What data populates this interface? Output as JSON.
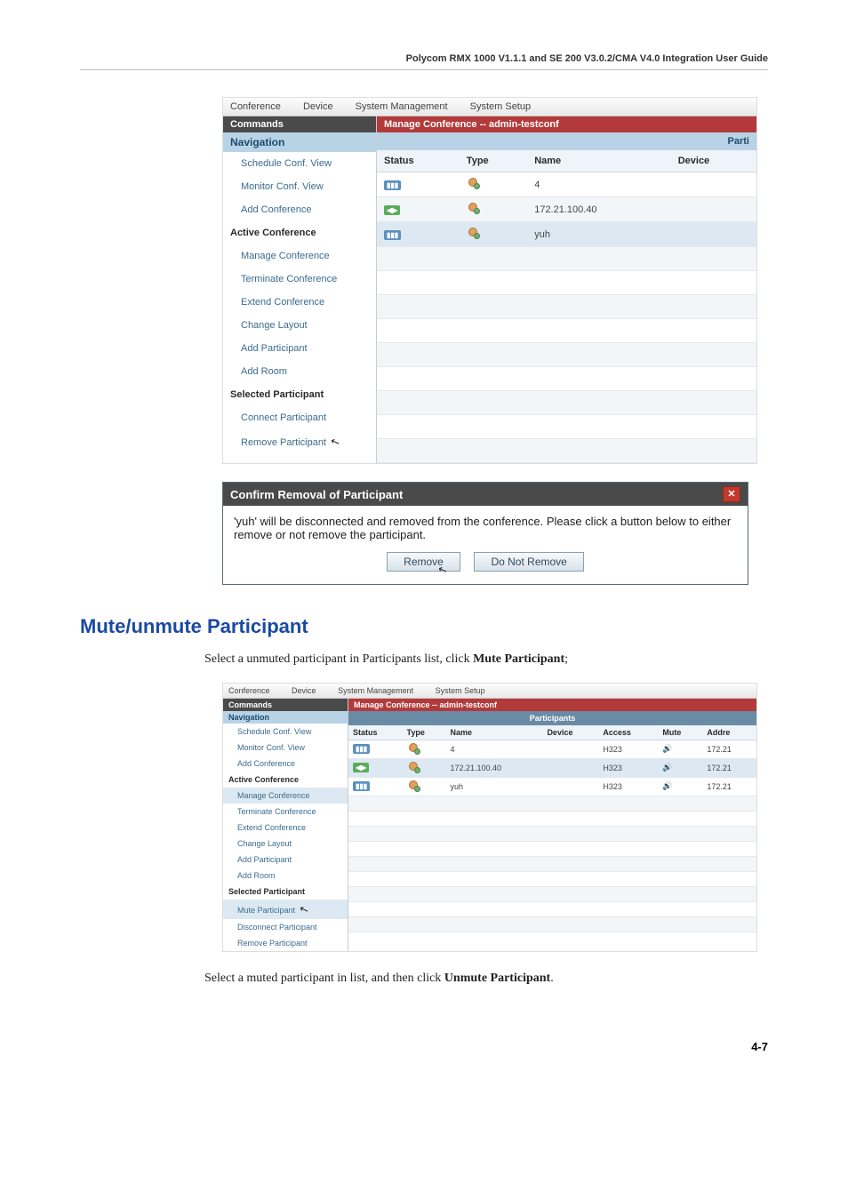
{
  "doc_header": "Polycom RMX 1000 V1.1.1 and SE 200 V3.0.2/CMA V4.0 Integration User Guide",
  "footer": "4-7",
  "menubar": [
    "Conference",
    "Device",
    "System Management",
    "System Setup"
  ],
  "sidebar": {
    "commands": "Commands",
    "navigation": "Navigation",
    "nav_items": [
      "Schedule Conf. View",
      "Monitor Conf. View",
      "Add Conference"
    ],
    "active_conf": "Active Conference",
    "active_items": [
      "Manage Conference",
      "Terminate Conference",
      "Extend Conference",
      "Change Layout",
      "Add Participant",
      "Add Room"
    ],
    "sel_part": "Selected Participant",
    "sel_items_1": [
      "Connect Participant",
      "Remove Participant"
    ]
  },
  "main1": {
    "title": "Manage Conference -- admin-testconf",
    "subhead": "Parti",
    "cols": [
      "Status",
      "Type",
      "Name",
      "Device"
    ],
    "rows": [
      {
        "status": "blue",
        "name": "4"
      },
      {
        "status": "green",
        "name": "172.21.100.40"
      },
      {
        "status": "blue",
        "name": "yuh"
      }
    ]
  },
  "dialog": {
    "title": "Confirm Removal of Participant",
    "msg": "'yuh' will be disconnected and removed from the conference.  Please click a button below to either remove or not remove the participant.",
    "remove": "Remove",
    "dont": "Do Not Remove"
  },
  "section_title": "Mute/unmute Participant",
  "body1_a": "Select a unmuted participant in Participants list, click ",
  "body1_b": "Mute Participant",
  "body1_c": ";",
  "body2_a": "Select a muted participant in list, and then click ",
  "body2_b": "Unmute Participant",
  "body2_c": ".",
  "ss2": {
    "sel_items": [
      "Mute Participant",
      "Disconnect Participant",
      "Remove Participant"
    ],
    "participants": "Participants",
    "cols": [
      "Status",
      "Type",
      "Name",
      "Device",
      "Access",
      "Mute",
      "Addre"
    ],
    "rows": [
      {
        "status": "blue",
        "name": "4",
        "access": "H323",
        "addr": "172.21"
      },
      {
        "status": "green",
        "name": "172.21.100.40",
        "access": "H323",
        "addr": "172.21"
      },
      {
        "status": "blue",
        "name": "yuh",
        "access": "H323",
        "addr": "172.21"
      }
    ]
  }
}
